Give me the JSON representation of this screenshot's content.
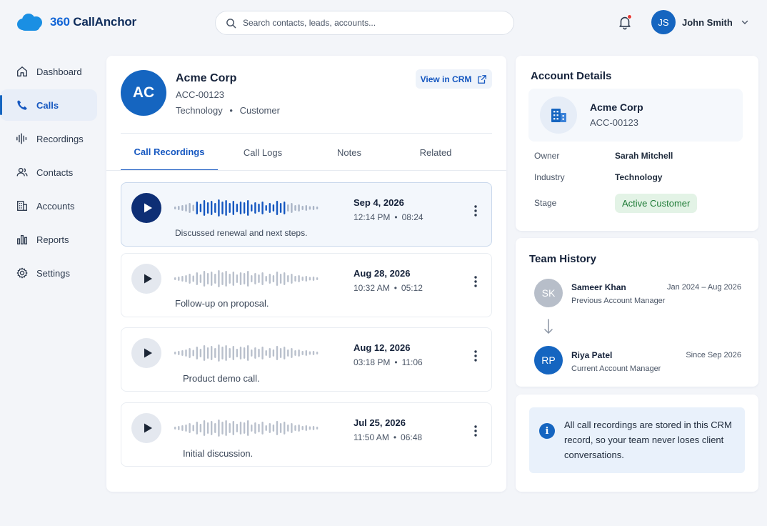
{
  "app": {
    "logo_prefix": "360",
    "logo_name": "CallAnchor",
    "brand_color": "#1265d6"
  },
  "search": {
    "placeholder": "Search contacts, leads, accounts...",
    "value": ""
  },
  "notifications": {
    "has_unread": true
  },
  "user": {
    "initials": "JS",
    "name": "John Smith"
  },
  "sidebar": {
    "items": [
      {
        "label": "Dashboard",
        "icon": "home-icon",
        "active": false
      },
      {
        "label": "Calls",
        "icon": "phone-icon",
        "active": true
      },
      {
        "label": "Recordings",
        "icon": "waveform-icon",
        "active": false
      },
      {
        "label": "Contacts",
        "icon": "contacts-icon",
        "active": false
      },
      {
        "label": "Accounts",
        "icon": "building-icon",
        "active": false
      },
      {
        "label": "Reports",
        "icon": "bar-chart-icon",
        "active": false
      },
      {
        "label": "Settings",
        "icon": "gear-icon",
        "active": false
      }
    ]
  },
  "account": {
    "initials": "AC",
    "name": "Acme Corp",
    "id": "ACC-00123",
    "industry": "Technology",
    "type": "Customer",
    "separator": "•",
    "view_button": "View in CRM"
  },
  "tabs": [
    {
      "label": "Call Recordings",
      "active": true
    },
    {
      "label": "Call Logs",
      "active": false
    },
    {
      "label": "Notes",
      "active": false
    },
    {
      "label": "Related",
      "active": false
    }
  ],
  "recordings": [
    {
      "date": "Sep 4, 2026",
      "time": "12:14 PM",
      "duration": "08:24",
      "description": "Discussed renewal and next steps.",
      "selected": true
    },
    {
      "date": "Aug 28, 2026",
      "time": "10:32 AM",
      "duration": "05:12",
      "description": "Follow-up on proposal.",
      "selected": false
    },
    {
      "date": "Aug 12, 2026",
      "time": "03:18 PM",
      "duration": "11:06",
      "description": "Product demo call.",
      "selected": false
    },
    {
      "date": "Jul 25, 2026",
      "time": "11:50 AM",
      "duration": "06:48",
      "description": "Initial discussion.",
      "selected": false
    }
  ],
  "account_details": {
    "title": "Account Details",
    "name": "Acme Corp",
    "id": "ACC-00123",
    "owner_label": "Owner",
    "owner": "Sarah Mitchell",
    "industry_label": "Industry",
    "industry": "Technology",
    "stage_label": "Stage",
    "stage": "Active Customer",
    "stage_color": "#1d7a35"
  },
  "team_history": {
    "title": "Team History",
    "members": [
      {
        "initials": "SK",
        "name": "Sameer Khan",
        "role": "Previous Account Manager",
        "period": "Jan 2024 – Aug 2026",
        "color": "#b7bec9"
      },
      {
        "initials": "RP",
        "name": "Riya Patel",
        "role": "Current Account Manager",
        "period": "Since Sep 2026",
        "color": "#1565c0"
      }
    ]
  },
  "info": {
    "icon": "i",
    "text": "All call recordings are stored in this CRM record, so your team never loses client conversations."
  }
}
